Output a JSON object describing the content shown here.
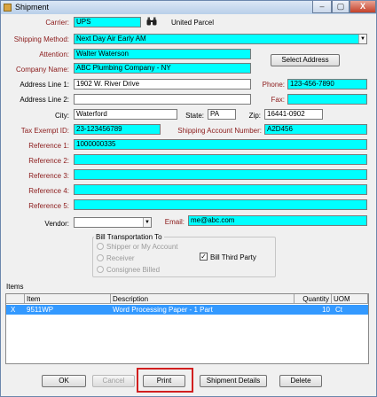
{
  "window": {
    "title": "Shipment",
    "controls": {
      "minimize": "–",
      "maximize": "▢",
      "close": "X"
    }
  },
  "carrier": {
    "label": "Carrier:",
    "value": "UPS",
    "name": "United Parcel"
  },
  "shipping_method": {
    "label": "Shipping Method:",
    "value": "Next Day Air Early AM"
  },
  "attention": {
    "label": "Attention:",
    "value": "Walter Waterson"
  },
  "company_name": {
    "label": "Company Name:",
    "value": "ABC Plumbing Company - NY"
  },
  "select_address_label": "Select Address",
  "address1": {
    "label": "Address Line 1:",
    "value": "1902 W. River Drive"
  },
  "address2": {
    "label": "Address Line 2:",
    "value": ""
  },
  "phone": {
    "label": "Phone:",
    "value": "123-456-7890"
  },
  "fax": {
    "label": "Fax:",
    "value": ""
  },
  "city": {
    "label": "City:",
    "value": "Waterford"
  },
  "state": {
    "label": "State:",
    "value": "PA"
  },
  "zip": {
    "label": "Zip:",
    "value": "16441-0902"
  },
  "tax_exempt": {
    "label": "Tax Exempt ID:",
    "value": "23-123456789"
  },
  "shipping_account": {
    "label": "Shipping Account Number:",
    "value": "A2D456"
  },
  "references": [
    {
      "label": "Reference 1:",
      "value": "1000000335"
    },
    {
      "label": "Reference 2:",
      "value": ""
    },
    {
      "label": "Reference 3:",
      "value": ""
    },
    {
      "label": "Reference 4:",
      "value": ""
    },
    {
      "label": "Reference 5:",
      "value": ""
    }
  ],
  "vendor": {
    "label": "Vendor:",
    "value": ""
  },
  "email": {
    "label": "Email:",
    "value": "me@abc.com"
  },
  "bill_transportation": {
    "title": "Bill Transportation To",
    "options": [
      "Shipper or My Account",
      "Receiver",
      "Consignee Billed"
    ],
    "third_party_label": "Bill Third Party",
    "third_party_checked": "✓"
  },
  "items": {
    "label": "Items",
    "columns": [
      "Item",
      "Description",
      "Quantity",
      "UOM"
    ],
    "rows": [
      {
        "marker": "X",
        "item": "9511WP",
        "description": "Word Processing Paper - 1 Part",
        "quantity": "10",
        "uom": "Ct"
      }
    ]
  },
  "buttons": {
    "ok": "OK",
    "cancel": "Cancel",
    "print": "Print",
    "shipment_details": "Shipment Details",
    "delete": "Delete"
  }
}
